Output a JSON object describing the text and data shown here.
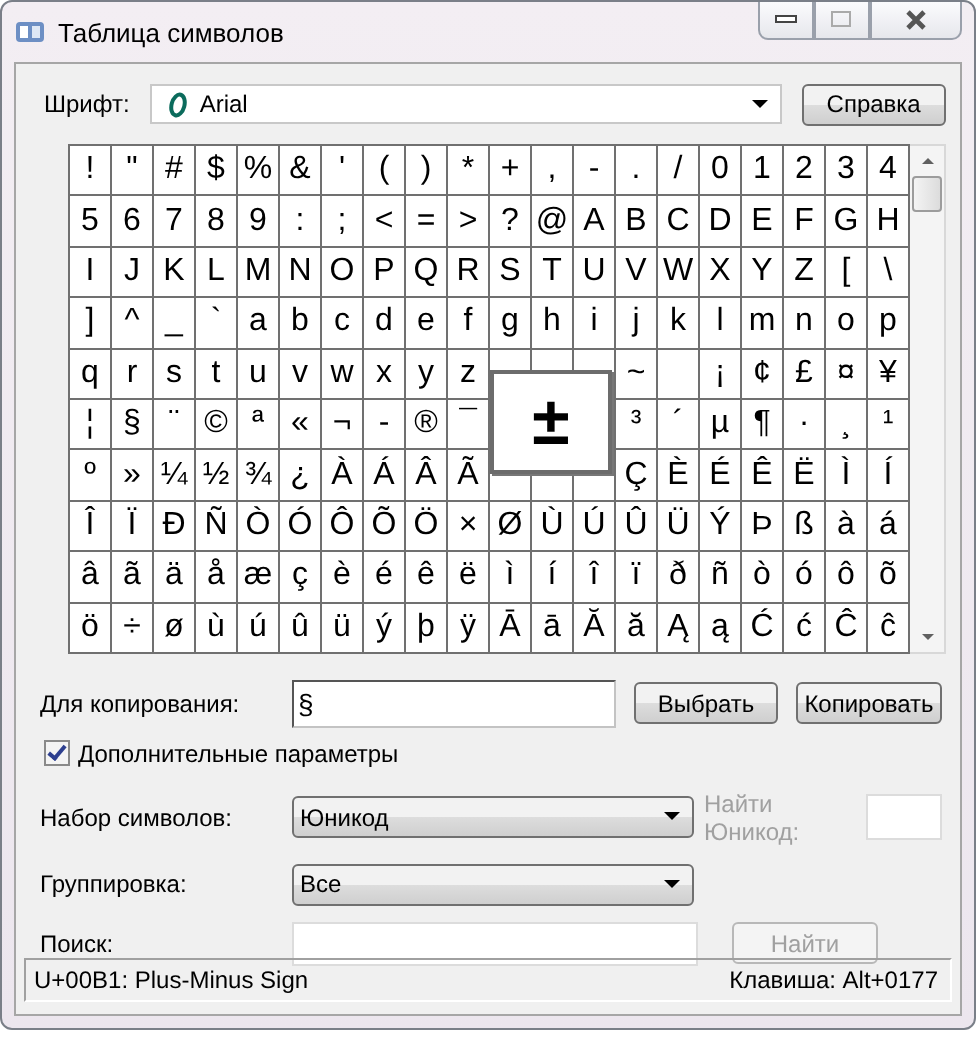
{
  "window": {
    "title": "Таблица символов"
  },
  "font": {
    "label": "Шрифт:",
    "value": "Arial"
  },
  "help_button": "Справка",
  "grid": {
    "rows": [
      [
        "!",
        "\"",
        "#",
        "$",
        "%",
        "&",
        "'",
        "(",
        ")",
        "*",
        "+",
        ",",
        "-",
        ".",
        "/",
        "0",
        "1",
        "2",
        "3",
        "4"
      ],
      [
        "5",
        "6",
        "7",
        "8",
        "9",
        ":",
        ";",
        "<",
        "=",
        ">",
        "?",
        "@",
        "A",
        "B",
        "C",
        "D",
        "E",
        "F",
        "G",
        "H"
      ],
      [
        "I",
        "J",
        "K",
        "L",
        "M",
        "N",
        "O",
        "P",
        "Q",
        "R",
        "S",
        "T",
        "U",
        "V",
        "W",
        "X",
        "Y",
        "Z",
        "[",
        "\\"
      ],
      [
        "]",
        "^",
        "_",
        "`",
        "a",
        "b",
        "c",
        "d",
        "e",
        "f",
        "g",
        "h",
        "i",
        "j",
        "k",
        "l",
        "m",
        "n",
        "o",
        "p"
      ],
      [
        "q",
        "r",
        "s",
        "t",
        "u",
        "v",
        "w",
        "x",
        "y",
        "z",
        null,
        null,
        null,
        "~",
        null,
        "¡",
        "¢",
        "£",
        "¤",
        "¥"
      ],
      [
        "¦",
        "§",
        "¨",
        "©",
        "ª",
        "«",
        "¬",
        "-",
        "®",
        "¯",
        null,
        null,
        null,
        "³",
        "´",
        "µ",
        "¶",
        "·",
        "¸",
        "¹"
      ],
      [
        "º",
        "»",
        "¼",
        "½",
        "¾",
        "¿",
        "À",
        "Á",
        "Â",
        "Ã",
        null,
        null,
        null,
        "Ç",
        "È",
        "É",
        "Ê",
        "Ë",
        "Ì",
        "Í"
      ],
      [
        "Î",
        "Ï",
        "Ð",
        "Ñ",
        "Ò",
        "Ó",
        "Ô",
        "Õ",
        "Ö",
        "×",
        "Ø",
        "Ù",
        "Ú",
        "Û",
        "Ü",
        "Ý",
        "Þ",
        "ß",
        "à",
        "á"
      ],
      [
        "â",
        "ã",
        "ä",
        "å",
        "æ",
        "ç",
        "è",
        "é",
        "ê",
        "ë",
        "ì",
        "í",
        "î",
        "ï",
        "ð",
        "ñ",
        "ò",
        "ó",
        "ô",
        "õ"
      ],
      [
        "ö",
        "÷",
        "ø",
        "ù",
        "ú",
        "û",
        "ü",
        "ý",
        "þ",
        "ÿ",
        "Ā",
        "ā",
        "Ă",
        "ă",
        "Ą",
        "ą",
        "Ć",
        "ć",
        "Ĉ",
        "ĉ"
      ]
    ]
  },
  "magnified": "±",
  "copy": {
    "label": "Для копирования:",
    "value": "§"
  },
  "select_button": "Выбрать",
  "copy_button": "Копировать",
  "advanced": {
    "label": "Дополнительные параметры",
    "checked": true
  },
  "charset": {
    "label": "Набор символов:",
    "value": "Юникод"
  },
  "find_unicode": {
    "label": "Найти Юникод:",
    "disabled": true
  },
  "grouping": {
    "label": "Группировка:",
    "value": "Все"
  },
  "search": {
    "label": "Поиск:",
    "button": "Найти",
    "button_disabled": true
  },
  "status_bar": {
    "left": "U+00B1: Plus-Minus Sign",
    "right": "Клавиша: Alt+0177"
  }
}
